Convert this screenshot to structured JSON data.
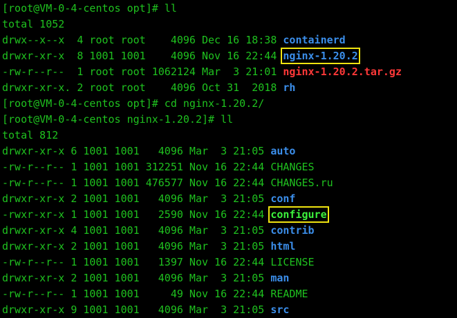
{
  "terminal": {
    "lines": [
      {
        "kind": "prompt",
        "text": "[root@VM-0-4-centos opt]# ll"
      },
      {
        "kind": "text",
        "text": "total 1052"
      },
      {
        "kind": "entry",
        "meta": "drwx--x--x  4 root root    4096 Dec 16 18:38 ",
        "name": "containerd",
        "style": "dir",
        "highlight": false
      },
      {
        "kind": "entry",
        "meta": "drwxr-xr-x  8 1001 1001    4096 Nov 16 22:44 ",
        "name": "nginx-1.20.2",
        "style": "dir",
        "highlight": true
      },
      {
        "kind": "entry",
        "meta": "-rw-r--r--  1 root root 1062124 Mar  3 21:01 ",
        "name": "nginx-1.20.2.tar.gz",
        "style": "archive",
        "highlight": false
      },
      {
        "kind": "entry",
        "meta": "drwxr-xr-x. 2 root root    4096 Oct 31  2018 ",
        "name": "rh",
        "style": "dir",
        "highlight": false
      },
      {
        "kind": "prompt",
        "text": "[root@VM-0-4-centos opt]# cd nginx-1.20.2/"
      },
      {
        "kind": "prompt",
        "text": "[root@VM-0-4-centos nginx-1.20.2]# ll"
      },
      {
        "kind": "text",
        "text": "total 812"
      },
      {
        "kind": "entry",
        "meta": "drwxr-xr-x 6 1001 1001   4096 Mar  3 21:05 ",
        "name": "auto",
        "style": "dir",
        "highlight": false
      },
      {
        "kind": "entry",
        "meta": "-rw-r--r-- 1 1001 1001 312251 Nov 16 22:44 ",
        "name": "CHANGES",
        "style": "plain",
        "highlight": false
      },
      {
        "kind": "entry",
        "meta": "-rw-r--r-- 1 1001 1001 476577 Nov 16 22:44 ",
        "name": "CHANGES.ru",
        "style": "plain",
        "highlight": false
      },
      {
        "kind": "entry",
        "meta": "drwxr-xr-x 2 1001 1001   4096 Mar  3 21:05 ",
        "name": "conf",
        "style": "dir",
        "highlight": false
      },
      {
        "kind": "entry",
        "meta": "-rwxr-xr-x 1 1001 1001   2590 Nov 16 22:44 ",
        "name": "configure",
        "style": "exec",
        "highlight": true
      },
      {
        "kind": "entry",
        "meta": "drwxr-xr-x 4 1001 1001   4096 Mar  3 21:05 ",
        "name": "contrib",
        "style": "dir",
        "highlight": false
      },
      {
        "kind": "entry",
        "meta": "drwxr-xr-x 2 1001 1001   4096 Mar  3 21:05 ",
        "name": "html",
        "style": "dir",
        "highlight": false
      },
      {
        "kind": "entry",
        "meta": "-rw-r--r-- 1 1001 1001   1397 Nov 16 22:44 ",
        "name": "LICENSE",
        "style": "plain",
        "highlight": false
      },
      {
        "kind": "entry",
        "meta": "drwxr-xr-x 2 1001 1001   4096 Mar  3 21:05 ",
        "name": "man",
        "style": "dir",
        "highlight": false
      },
      {
        "kind": "entry",
        "meta": "-rw-r--r-- 1 1001 1001     49 Nov 16 22:44 ",
        "name": "README",
        "style": "plain",
        "highlight": false
      },
      {
        "kind": "entry",
        "meta": "drwxr-xr-x 9 1001 1001   4096 Mar  3 21:05 ",
        "name": "src",
        "style": "dir",
        "highlight": false
      }
    ]
  },
  "colors": {
    "background": "#000000",
    "text": "#1fc21f",
    "directory": "#3b8eea",
    "archive": "#ff3838",
    "executable": "#3cf03c",
    "highlight_box": "#f1e510"
  }
}
